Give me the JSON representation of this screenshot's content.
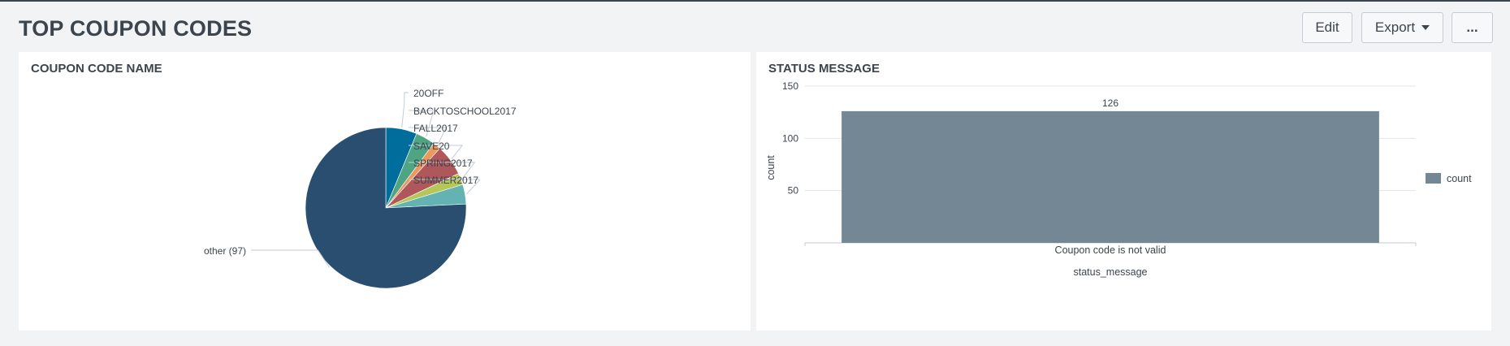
{
  "dashboard": {
    "title": "TOP COUPON CODES",
    "buttons": {
      "edit": "Edit",
      "export": "Export",
      "more": "..."
    }
  },
  "panels": {
    "left": {
      "title": "COUPON CODE NAME"
    },
    "right": {
      "title": "STATUS MESSAGE"
    }
  },
  "chart_data": [
    {
      "type": "pie",
      "title": "COUPON CODE NAME",
      "slices": [
        {
          "label": "20OFF",
          "value": 8,
          "color": "#006d9c"
        },
        {
          "label": "BACKTOSCHOOL2017",
          "value": 5,
          "color": "#4fa484"
        },
        {
          "label": "FALL2017",
          "value": 2,
          "color": "#ec9960"
        },
        {
          "label": "SAVE20",
          "value": 8,
          "color": "#af575a"
        },
        {
          "label": "SPRING2017",
          "value": 3,
          "color": "#b6c75a"
        },
        {
          "label": "SUMMER2017",
          "value": 5,
          "color": "#62b3b2"
        },
        {
          "label": "other (97)",
          "value": 97,
          "color": "#294e70"
        }
      ]
    },
    {
      "type": "bar",
      "title": "STATUS MESSAGE",
      "categories": [
        "Coupon code is not valid"
      ],
      "series": [
        {
          "name": "count",
          "values": [
            126
          ],
          "color": "#738795"
        }
      ],
      "data_labels": [
        "126"
      ],
      "xlabel": "status_message",
      "ylabel": "count",
      "ylim": [
        0,
        150
      ],
      "yticks": [
        "50",
        "100",
        "150"
      ],
      "grid": true,
      "legend": "right"
    }
  ]
}
